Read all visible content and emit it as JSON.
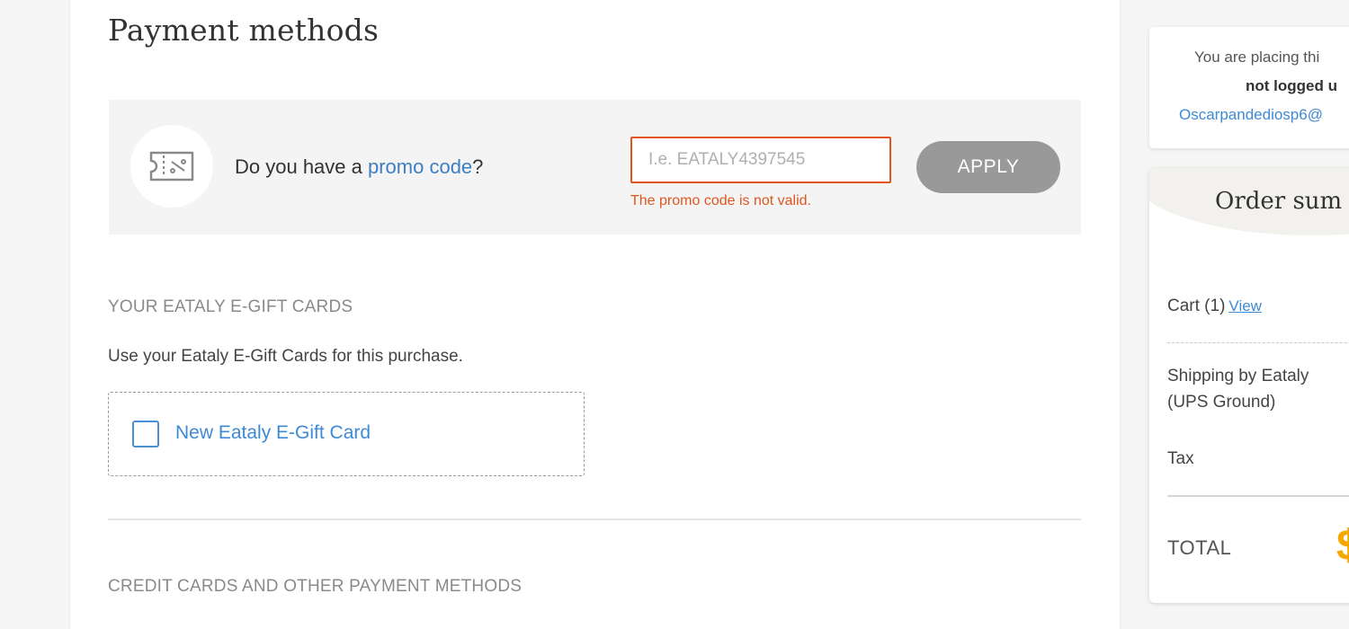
{
  "page": {
    "title": "Payment methods"
  },
  "promo": {
    "question_prefix": "Do you have a ",
    "question_link": "promo code",
    "question_suffix": "?",
    "input_placeholder": "I.e. EATALY4397545",
    "input_value": "",
    "error": "The promo code is not valid.",
    "apply_label": "APPLY",
    "icon": "coupon-ticket-icon"
  },
  "gift_cards": {
    "heading": "YOUR EATALY E-GIFT CARDS",
    "description": "Use your Eataly E-Gift Cards for this purchase.",
    "new_card_label": "New Eataly E-Gift Card",
    "checked": false
  },
  "credit_cards": {
    "heading": "CREDIT CARDS AND OTHER PAYMENT METHODS"
  },
  "login_notice": {
    "line1": "You are placing thi",
    "line2": "not logged u",
    "email": "Oscarpandediosp6@"
  },
  "order_summary": {
    "title": "Order sum",
    "cart_label": "Cart (1)",
    "view_link": "View",
    "shipping_line1": "Shipping by Eataly",
    "shipping_line2": "(UPS Ground)",
    "tax_label": "Tax",
    "total_label": "TOTAL",
    "total_value_partial": "$"
  },
  "colors": {
    "link_blue": "#3d7fc2",
    "error_orange": "#e0561e",
    "apply_gray": "#999999",
    "total_gold": "#f5a800"
  }
}
